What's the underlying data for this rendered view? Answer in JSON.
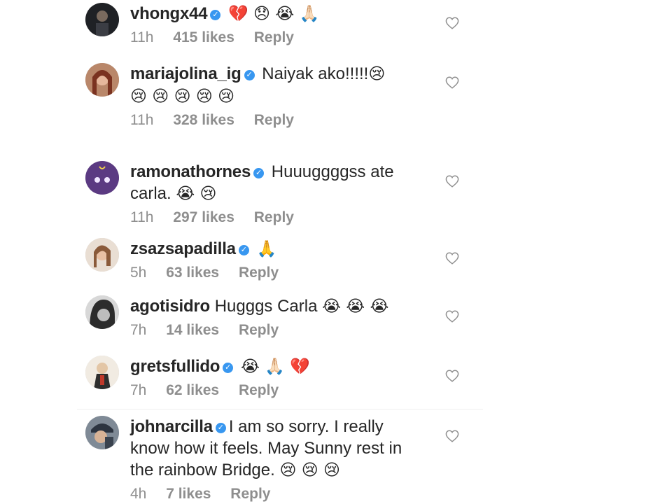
{
  "comments": [
    {
      "username": "vhongx44",
      "verified": true,
      "text": "",
      "emoji": "💔 😞 😭 🙏🏻",
      "time": "11h",
      "likes": "415 likes",
      "reply": "Reply",
      "avatar_color": "#2b2b30"
    },
    {
      "username": "mariajolina_ig",
      "verified": true,
      "text": "Naiyak ako!!!!!",
      "emoji": "😢",
      "emoji2": "😢 😢 😢 😢 😢",
      "time": "11h",
      "likes": "328 likes",
      "reply": "Reply",
      "avatar_color": "#c4623e"
    },
    {
      "username": "ramonathornes",
      "verified": true,
      "text": "Huuuggggss ate",
      "text2": "carla.",
      "emoji2": "😭 😢",
      "time": "11h",
      "likes": "297 likes",
      "reply": "Reply",
      "avatar_color": "#5b3a82"
    },
    {
      "username": "zsazsapadilla",
      "verified": true,
      "text": "",
      "emoji": "🙏",
      "time": "5h",
      "likes": "63 likes",
      "reply": "Reply",
      "avatar_color": "#d9c2b0"
    },
    {
      "username": "agotisidro",
      "verified": false,
      "text": "Hugggs Carla",
      "emoji": "😭 😭 😭",
      "time": "7h",
      "likes": "14 likes",
      "reply": "Reply",
      "avatar_color": "#9a9a9a"
    },
    {
      "username": "gretsfullido",
      "verified": true,
      "text": "",
      "emoji": "😭 🙏🏻 💔",
      "time": "7h",
      "likes": "62 likes",
      "reply": "Reply",
      "avatar_color": "#e8dccc"
    },
    {
      "username": "johnarcilla",
      "verified": true,
      "text": "I am so sorry. I really",
      "text2": "know how it feels. May Sunny rest in",
      "text3": "the rainbow Bridge.",
      "emoji3": "😢 😢 😢",
      "time": "4h",
      "likes": "7 likes",
      "reply": "Reply",
      "avatar_color": "#6f7a86"
    }
  ],
  "colors": {
    "verified": "#3897f0",
    "meta": "#8e8e8e",
    "text": "#262626"
  },
  "icons": {
    "like": "heart-outline-icon",
    "verified": "verified-badge-icon"
  }
}
